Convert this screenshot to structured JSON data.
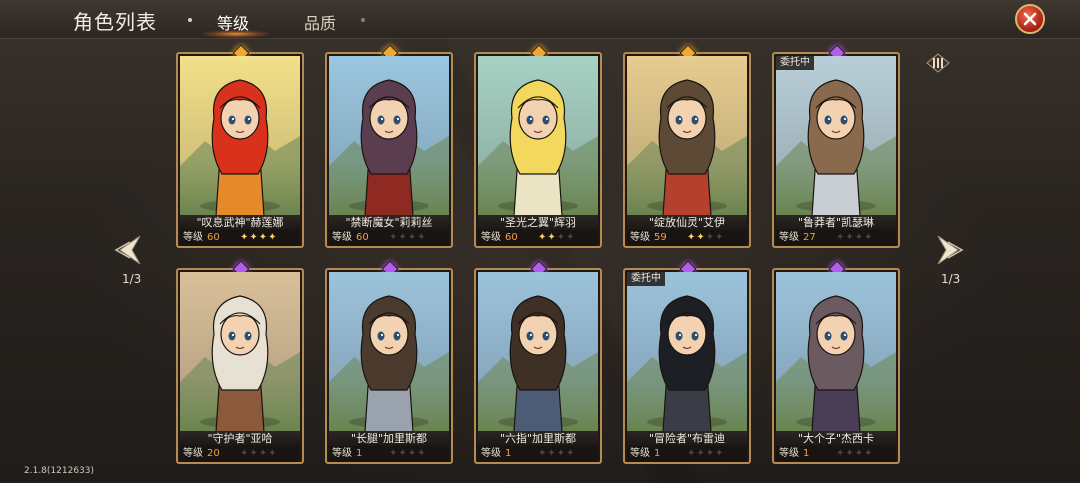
{
  "header": {
    "title": "角色列表",
    "tabs": [
      {
        "label": "等级",
        "active": true
      },
      {
        "label": "品质",
        "active": false
      }
    ]
  },
  "pagination": {
    "left": "1/3",
    "right": "1/3"
  },
  "version": "2.1.8(1212633)",
  "level_label": "等级",
  "cards": [
    {
      "name": "\"叹息武神\"赫莲娜",
      "level": "60",
      "stars": 4,
      "max_stars": 4,
      "gem": "#f0a830",
      "badge": "",
      "palette": {
        "sky": "#f3e08a",
        "hair": "#d8321c",
        "body": "#e48a2a"
      }
    },
    {
      "name": "\"禁断魔女\"莉莉丝",
      "level": "60",
      "stars": 0,
      "max_stars": 4,
      "gem": "#f0a830",
      "badge": "",
      "palette": {
        "sky": "#9bc7e0",
        "hair": "#5a3d4e",
        "body": "#8e2a22"
      }
    },
    {
      "name": "\"圣光之翼\"辉羽",
      "level": "60",
      "stars": 2,
      "max_stars": 4,
      "gem": "#f0a830",
      "badge": "",
      "palette": {
        "sky": "#a7d1c4",
        "hair": "#f2d85c",
        "body": "#eae3c4"
      }
    },
    {
      "name": "\"绽放仙灵\"艾伊",
      "level": "59",
      "stars": 2,
      "max_stars": 4,
      "gem": "#f0a830",
      "badge": "",
      "palette": {
        "sky": "#e7cc8f",
        "hair": "#5c4a36",
        "body": "#b5402e"
      }
    },
    {
      "name": "\"鲁莽者\"凯瑟琳",
      "level": "27",
      "stars": 0,
      "max_stars": 4,
      "gem": "#b35cf0",
      "badge": "委托中",
      "palette": {
        "sky": "#b9cfd8",
        "hair": "#8a6a4c",
        "body": "#c9cdd4"
      }
    },
    {
      "name": "\"守护者\"亚哈",
      "level": "20",
      "stars": 0,
      "max_stars": 4,
      "gem": "#b35cf0",
      "badge": "",
      "palette": {
        "sky": "#d9c09a",
        "hair": "#e7e1d4",
        "body": "#8a5a3a"
      }
    },
    {
      "name": "\"长腿\"加里斯都",
      "level": "1",
      "stars": 0,
      "max_stars": 4,
      "gem": "#b35cf0",
      "badge": "",
      "palette": {
        "sky": "#9cc3dc",
        "hair": "#4b3a2e",
        "body": "#9aa2ad"
      }
    },
    {
      "name": "\"六指\"加里斯都",
      "level": "1",
      "stars": 0,
      "max_stars": 4,
      "gem": "#b35cf0",
      "badge": "",
      "palette": {
        "sky": "#9cc3dc",
        "hair": "#3e3024",
        "body": "#4d5c75"
      }
    },
    {
      "name": "\"冒险者\"布雷迪",
      "level": "1",
      "stars": 0,
      "max_stars": 4,
      "gem": "#b35cf0",
      "badge": "委托中",
      "palette": {
        "sky": "#9cc3dc",
        "hair": "#1d1f25",
        "body": "#3a3d46"
      }
    },
    {
      "name": "\"大个子\"杰西卡",
      "level": "1",
      "stars": 0,
      "max_stars": 4,
      "gem": "#b35cf0",
      "badge": "",
      "palette": {
        "sky": "#9cc3dc",
        "hair": "#6b5a60",
        "body": "#4a3d56"
      }
    }
  ],
  "icons": {
    "close": "close-icon",
    "prev": "chevron-left-icon",
    "next": "chevron-right-icon",
    "list_toggle": "bars-icon"
  }
}
